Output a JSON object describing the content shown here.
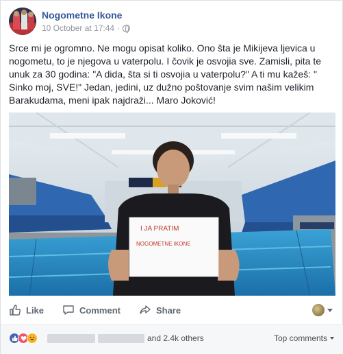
{
  "post": {
    "page_name": "Nogometne Ikone",
    "timestamp": "10 October at 17:44",
    "separator": "·",
    "privacy_icon": "globe-icon",
    "text": "Srce mi je ogromno. Ne mogu opisat koliko. Ono šta je Mikijeva ljevica u nogometu, to je njegova u vaterpolu. I čovik je osvojia sve. Zamisli, pita te unuk za 30 godina: \"A dida, šta si ti osvojia u vaterpolu?\" A ti mu kažeš: \" Sinko moj, SVE!\" Jedan, jedini, uz dužno poštovanje svim našim velikim Barakudama, meni ipak najdraži... Maro Joković!",
    "sign_line1": "I   JA   PRATIM",
    "sign_line2": "NOGOMETNE   IKONE"
  },
  "actions": {
    "like_label": "Like",
    "comment_label": "Comment",
    "share_label": "Share"
  },
  "reactions": {
    "others_text": "and 2.4k others",
    "sort_label": "Top comments",
    "icons": [
      "like-reaction-icon",
      "love-reaction-icon",
      "haha-reaction-icon"
    ]
  },
  "colors": {
    "link_blue": "#365899",
    "like_blue": "#4267b2",
    "love_red": "#f25268",
    "haha_yellow": "#f7b125"
  }
}
